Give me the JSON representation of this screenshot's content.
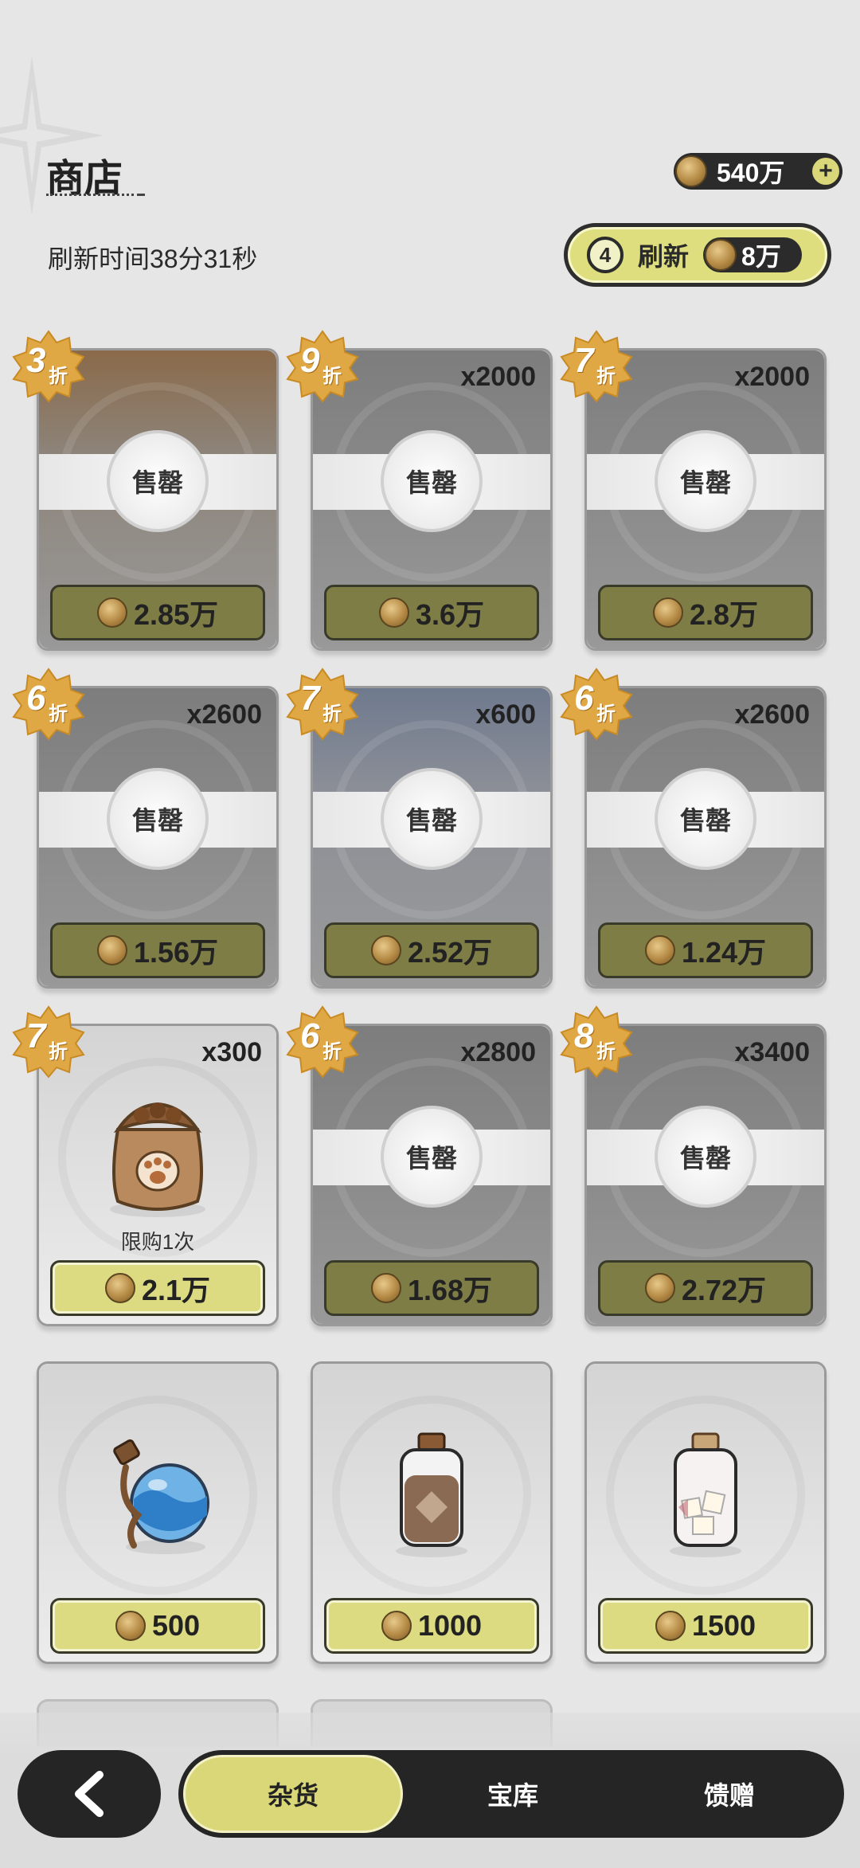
{
  "header": {
    "title": "商店",
    "currency": {
      "icon": "gold-coin-icon",
      "value": "540万"
    },
    "refresh_time": "刷新时间38分31秒",
    "refresh_button": {
      "count": "4",
      "label": "刷新",
      "cost": "8万"
    }
  },
  "items": [
    {
      "state": "soldout",
      "discount": "3",
      "discount_suffix": "折",
      "qty": "",
      "soldout_label": "售罄",
      "price": "2.85万"
    },
    {
      "state": "soldout",
      "discount": "9",
      "discount_suffix": "折",
      "qty": "x2000",
      "soldout_label": "售罄",
      "price": "3.6万"
    },
    {
      "state": "soldout",
      "discount": "7",
      "discount_suffix": "折",
      "qty": "x2000",
      "soldout_label": "售罄",
      "price": "2.8万"
    },
    {
      "state": "soldout",
      "discount": "6",
      "discount_suffix": "折",
      "qty": "x2600",
      "soldout_label": "售罄",
      "price": "1.56万"
    },
    {
      "state": "soldout",
      "discount": "7",
      "discount_suffix": "折",
      "qty": "x600",
      "soldout_label": "售罄",
      "price": "2.52万"
    },
    {
      "state": "soldout",
      "discount": "6",
      "discount_suffix": "折",
      "qty": "x2600",
      "soldout_label": "售罄",
      "price": "1.24万"
    },
    {
      "state": "available",
      "discount": "7",
      "discount_suffix": "折",
      "qty": "x300",
      "limit": "限购1次",
      "icon": "cat-food-sack-icon",
      "price": "2.1万"
    },
    {
      "state": "soldout",
      "discount": "6",
      "discount_suffix": "折",
      "qty": "x2800",
      "soldout_label": "售罄",
      "price": "1.68万"
    },
    {
      "state": "soldout",
      "discount": "8",
      "discount_suffix": "折",
      "qty": "x3400",
      "soldout_label": "售罄",
      "price": "2.72万"
    },
    {
      "state": "available",
      "icon": "blue-potion-flask-icon",
      "price": "500"
    },
    {
      "state": "available",
      "icon": "brown-powder-jar-icon",
      "price": "1000"
    },
    {
      "state": "available",
      "icon": "white-cubes-jar-icon",
      "price": "1500"
    }
  ],
  "nav": {
    "back_icon": "chevron-left-icon",
    "tabs": [
      {
        "label": "杂货",
        "active": true
      },
      {
        "label": "宝库",
        "active": false
      },
      {
        "label": "馈赠",
        "active": false
      }
    ]
  },
  "colors": {
    "accent": "#d9d777",
    "dark": "#252525",
    "soldout_price": "#7e7d45"
  }
}
